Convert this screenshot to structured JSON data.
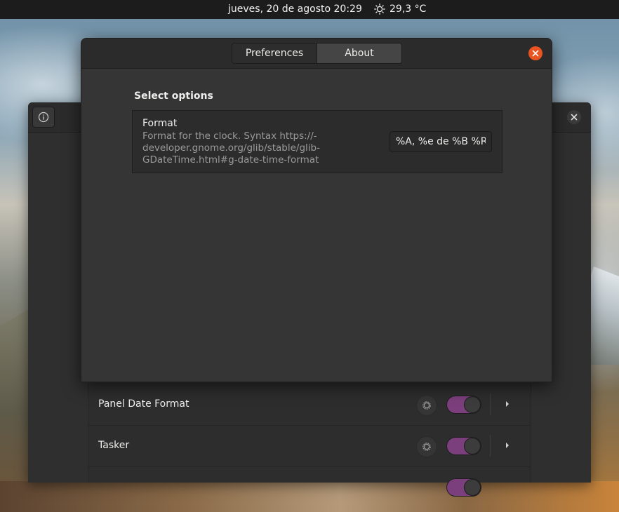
{
  "topbar": {
    "clock": "jueves, 20 de agosto 20:29",
    "weather": "29,3 °C",
    "weather_icon": "sun-icon"
  },
  "dialog": {
    "tabs": [
      {
        "label": "Preferences",
        "active": false
      },
      {
        "label": "About",
        "active": true
      }
    ],
    "section_title": "Select options",
    "option": {
      "title": "Format",
      "description": "Format for the clock. Syntax https://-developer.gnome.org/glib/stable/glib-GDateTime.html#g-date-time-format",
      "value": "%A, %e de %B %R"
    },
    "close_color": "#e95420"
  },
  "extensions": {
    "items": [
      {
        "name": "Panel Date Format",
        "enabled": true
      },
      {
        "name": "Tasker",
        "enabled": true
      }
    ],
    "toggle_color": "#7c3f7d"
  }
}
